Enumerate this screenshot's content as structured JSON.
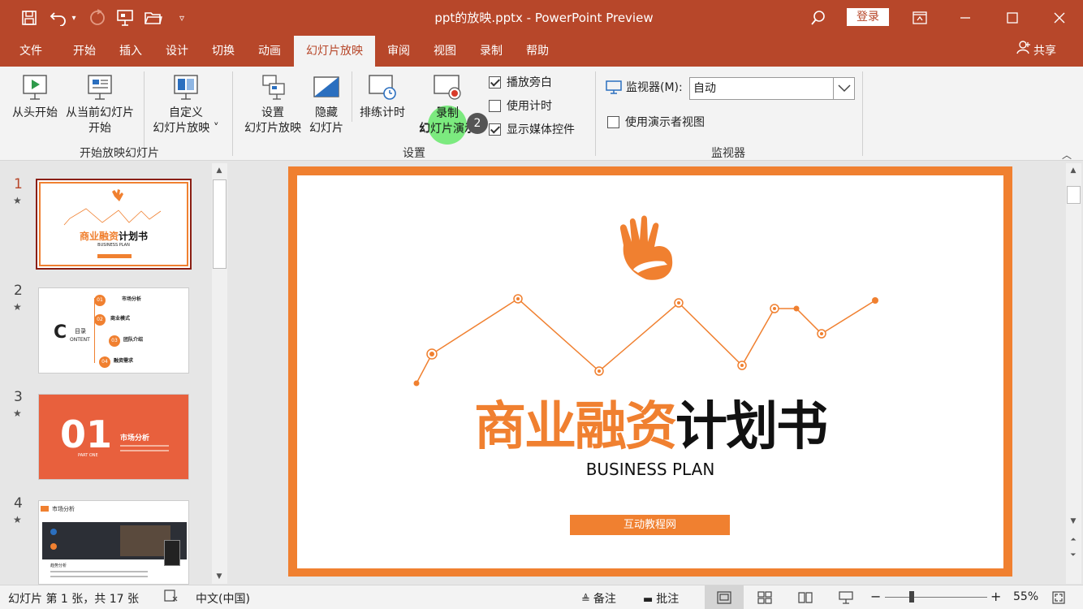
{
  "window": {
    "title": "ppt的放映.pptx  -  PowerPoint Preview",
    "login_label": "登录"
  },
  "menu": {
    "items": [
      "文件",
      "开始",
      "插入",
      "设计",
      "切换",
      "动画",
      "幻灯片放映",
      "审阅",
      "视图",
      "录制",
      "帮助"
    ],
    "active": "幻灯片放映",
    "share_label": "共享"
  },
  "ribbon": {
    "start_group": {
      "label": "开始放映幻灯片",
      "from_beginning": "从头开始",
      "from_current_line1": "从当前幻灯片",
      "from_current_line2": "开始",
      "custom_line1": "自定义",
      "custom_line2": "幻灯片放映 ˅"
    },
    "setup_group": {
      "label": "设置",
      "setup_line1": "设置",
      "setup_line2": "幻灯片放映",
      "hide_line1": "隐藏",
      "hide_line2": "幻灯片",
      "rehearse": "排练计时",
      "record_line1": "录制",
      "record_line2": "幻灯片演示",
      "checkboxes": [
        {
          "label": "播放旁白",
          "checked": true
        },
        {
          "label": "使用计时",
          "checked": false
        },
        {
          "label": "显示媒体控件",
          "checked": true
        }
      ],
      "badge": "2"
    },
    "monitor_group": {
      "label": "监视器",
      "monitor_label": "监视器(M):",
      "monitor_value": "自动",
      "presenter_view": "使用演示者视图",
      "presenter_checked": false
    }
  },
  "thumbnails": [
    {
      "num": "1",
      "star": "★",
      "title_orange": "商业融资",
      "title_black": "计划书",
      "sub": "BUSINESS PLAN"
    },
    {
      "num": "2",
      "star": "★",
      "c_letter": "C",
      "label_top": "目录",
      "label_bottom": "ONTENT",
      "items": [
        {
          "n": "01",
          "t": "市场分析"
        },
        {
          "n": "02",
          "t": "商业模式"
        },
        {
          "n": "03",
          "t": "团队介绍"
        },
        {
          "n": "04",
          "t": "融资需求"
        }
      ]
    },
    {
      "num": "3",
      "star": "★",
      "big": "01",
      "title": "市场分析",
      "part": "PART ONE"
    },
    {
      "num": "4",
      "star": "★",
      "header": "市场分析",
      "sub": "趋势分析"
    }
  ],
  "slide": {
    "title_orange": "商业融资",
    "title_black": "计划书",
    "subtitle": "BUSINESS PLAN",
    "button_label": "互动教程网",
    "colors": {
      "accent": "#f08030",
      "brand": "#b7472a"
    }
  },
  "status": {
    "slide_info": "幻灯片 第 1 张，共 17 张",
    "language": "中文(中国)",
    "notes": "备注",
    "comments": "批注",
    "zoom": "55%"
  }
}
